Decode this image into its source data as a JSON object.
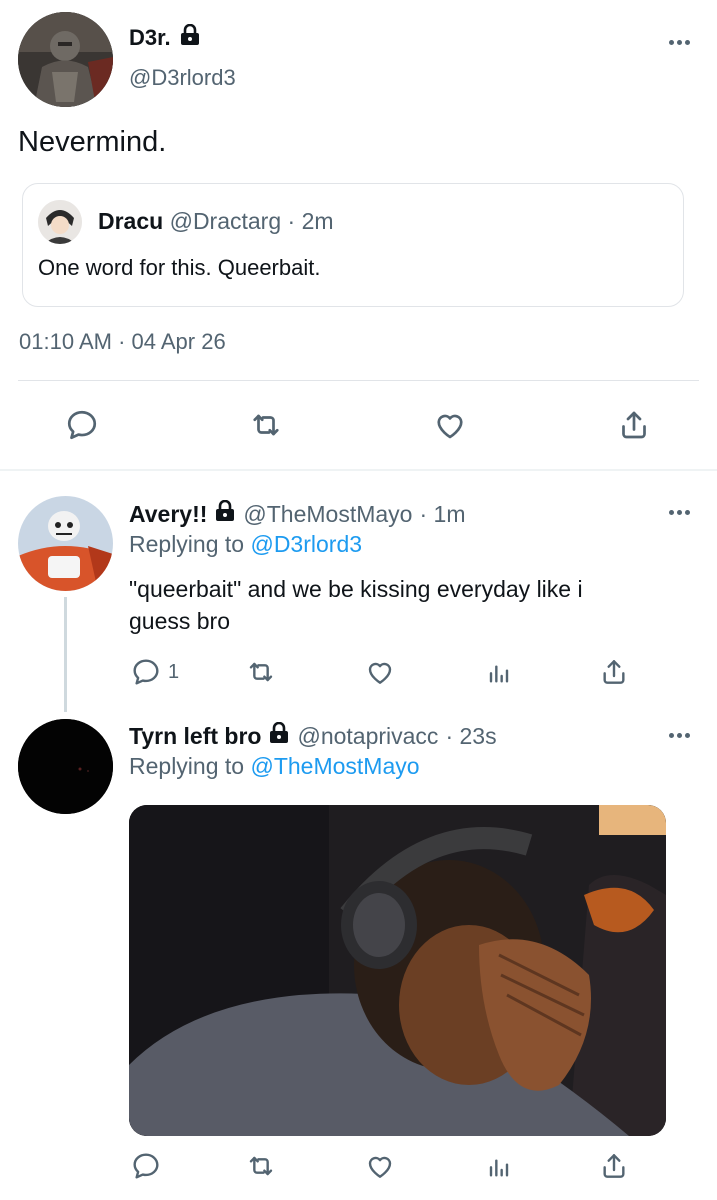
{
  "main_tweet": {
    "display_name": "D3r.",
    "handle": "@D3rlord3",
    "text": "Nevermind.",
    "timestamp": "01:10 AM · 04 Apr 26",
    "avatar_icon": "armored-knight-avatar",
    "quote": {
      "display_name": "Dracu",
      "handle": "@Dractarg",
      "time": "· 2m",
      "text": "One word for this. Queerbait.",
      "avatar_icon": "anime-character-avatar"
    },
    "actions": [
      "reply-icon",
      "retweet-icon",
      "like-icon",
      "share-icon"
    ]
  },
  "replies": [
    {
      "display_name": "Avery!!",
      "handle": "@TheMostMayo",
      "time": "· 1m",
      "replying_prefix": "Replying to ",
      "replying_to": "@D3rlord3",
      "text_line1": "\"queerbait\" and we be kissing everyday like i",
      "text_line2": "guess bro",
      "reply_count": "1",
      "avatar_icon": "skeleton-character-avatar"
    },
    {
      "display_name": "Tyrn left bro",
      "handle": "@notaprivacc",
      "time": "· 23s",
      "replying_prefix": "Replying to ",
      "replying_to": "@TheMostMayo",
      "avatar_icon": "dark-avatar",
      "media_icon": "facepalm-headphones-photo"
    }
  ],
  "colors": {
    "link": "#1d9bf0",
    "muted": "#536471",
    "divider": "#e1e4e8"
  }
}
